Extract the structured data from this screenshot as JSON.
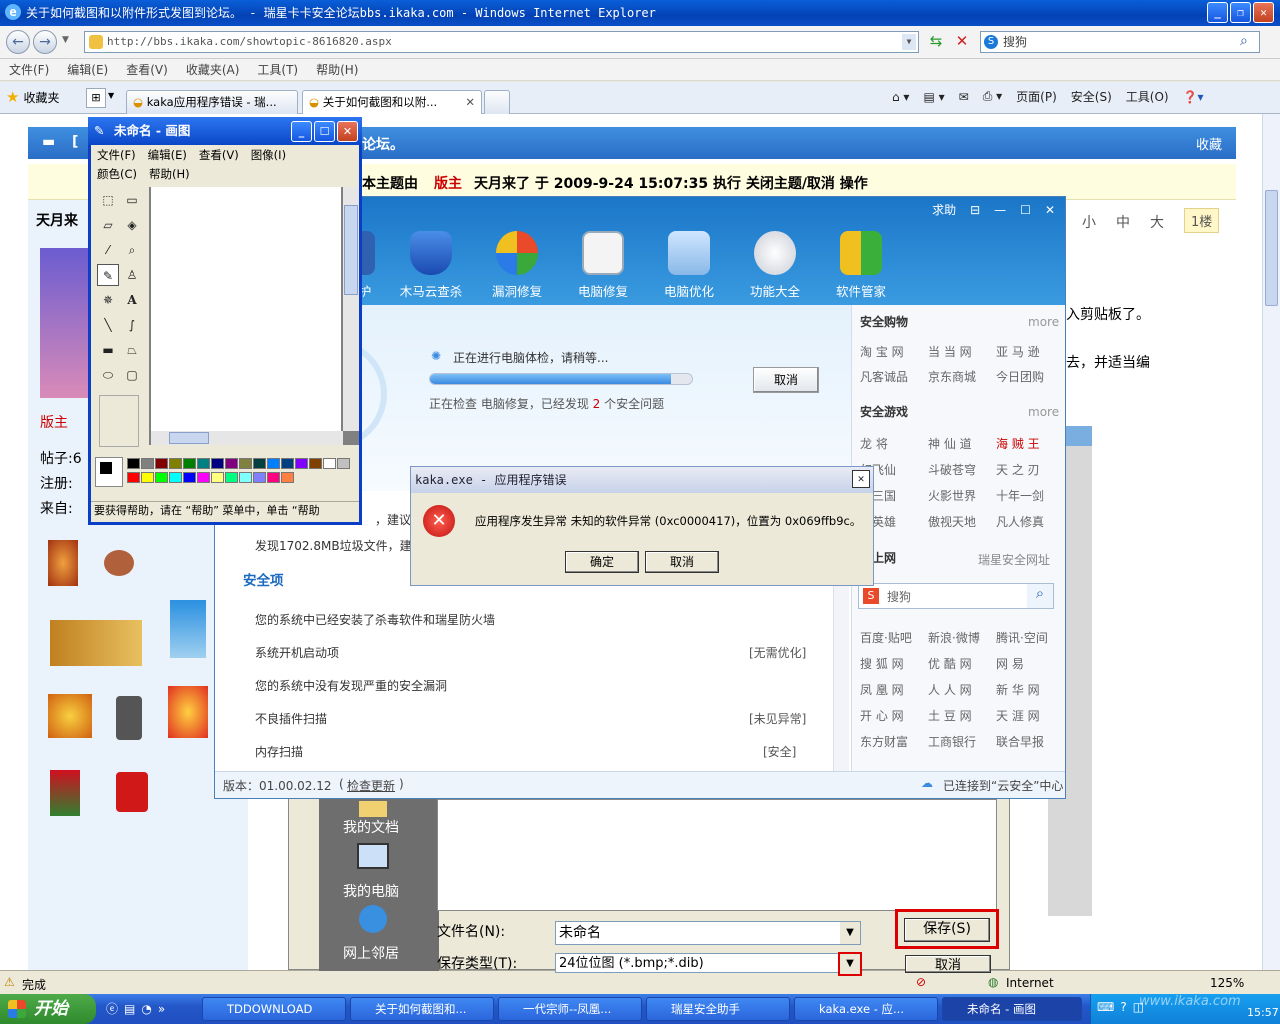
{
  "ie": {
    "title": "关于如何截图和以附件形式发图到论坛。 - 瑞星卡卡安全论坛bbs.ikaka.com - Windows Internet Explorer",
    "url": "http://bbs.ikaka.com/showtopic-8616820.aspx",
    "search_placeholder": "搜狗",
    "menu": [
      "文件(F)",
      "编辑(E)",
      "查看(V)",
      "收藏夹(A)",
      "工具(T)",
      "帮助(H)"
    ],
    "favorites": "收藏夹",
    "tabs": [
      "kaka应用程序错误 - 瑞...",
      "关于如何截图和以附..."
    ],
    "toolbar": [
      "页面(P)",
      "安全(S)",
      "工具(O)"
    ],
    "status": "完成",
    "zone": "Internet",
    "zoom": "125%"
  },
  "forum": {
    "header_title": "[",
    "header_title_tail": "论坛。",
    "header_fav": "收藏",
    "notice": "本主题由",
    "notice_role": "版主",
    "notice_rest": "天月来了 于 2009-9-24 15:07:35 执行 关闭主题/取消 操作",
    "author_name": "天月来",
    "font_small": "小",
    "font_mid": "中",
    "font_large": "大",
    "floor": "1楼",
    "role": "版主",
    "stat_posts": "帖子:6",
    "stat_reg": "注册:",
    "stat_from": "来自:",
    "text1": "入剪贴板了。",
    "text2": "去，并适当编"
  },
  "paint": {
    "title": "未命名 - 画图",
    "menu1": [
      "文件(F)",
      "编辑(E)",
      "查看(V)",
      "图像(I)"
    ],
    "menu2": [
      "颜色(C)",
      "帮助(H)"
    ],
    "status": "要获得帮助，请在 “帮助” 菜单中，单击 “帮助"
  },
  "kaka": {
    "help": "求助",
    "icons": [
      "护",
      "木马云查杀",
      "漏洞修复",
      "电脑修复",
      "电脑优化",
      "功能大全",
      "软件管家"
    ],
    "check_text": "正在进行电脑体检，请稍等...",
    "progress": 0.92,
    "cancel": "取消",
    "check_status_a": "正在检查 电脑修复，已经发现",
    "check_status_num": "2",
    "check_status_b": "个安全问题",
    "row_partial1": "，建议",
    "row_junk": "发现1702.8MB垃圾文件，建议",
    "section": "安全项",
    "rows": [
      {
        "text": "您的系统中已经安装了杀毒软件和瑞星防火墙",
        "status": ""
      },
      {
        "text": "系统开机启动项",
        "status": "[无需优化]"
      },
      {
        "text": "您的系统中没有发现严重的安全漏洞",
        "status": ""
      },
      {
        "text": "不良插件扫描",
        "status": "[未见异常]"
      },
      {
        "text": "内存扫描",
        "status": "[安全]"
      }
    ],
    "version": "版本：01.00.02.12",
    "check_update": "检查更新",
    "cloud": "已连接到“云安全”中心",
    "shop_title": "安全购物",
    "more": "more",
    "shop_links": [
      [
        "淘 宝 网",
        "当 当 网",
        "亚 马 逊"
      ],
      [
        "凡客诚品",
        "京东商城",
        "今日团购"
      ]
    ],
    "game_title": "安全游戏",
    "game_links": [
      [
        "龙 将",
        "神 仙 道",
        "海 贼 王"
      ],
      [
        "幻飞仙",
        "斗破苍穹",
        "天 之 刃"
      ],
      [
        "世三国",
        "火影世界",
        "十年一剑"
      ],
      [
        "地英雄",
        "傲视天地",
        "凡人修真"
      ]
    ],
    "web_title": "全上网",
    "web_site": "瑞星安全网址",
    "search_placeholder": "搜狗",
    "web_links": [
      [
        "百度·贴吧",
        "新浪·微博",
        "腾讯·空间"
      ],
      [
        "搜 狐 网",
        "优 酷 网",
        "网 易"
      ],
      [
        "凤 凰 网",
        "人 人 网",
        "新 华 网"
      ],
      [
        "开 心 网",
        "土 豆 网",
        "天 涯 网"
      ],
      [
        "东方财富",
        "工商银行",
        "联合早报"
      ]
    ]
  },
  "error": {
    "title": "kaka.exe - 应用程序错误",
    "message": "应用程序发生异常 未知的软件异常 (0xc0000417)，位置为 0x069ffb9c。",
    "ok": "确定",
    "cancel": "取消"
  },
  "save": {
    "places": [
      "我的文档",
      "我的电脑",
      "网上邻居"
    ],
    "filename_label": "文件名(N):",
    "filename_value": "未命名",
    "filetype_label": "保存类型(T):",
    "filetype_value": "24位位图 (*.bmp;*.dib)",
    "save_btn": "保存(S)",
    "cancel_btn": "取消"
  },
  "taskbar": {
    "start": "开始",
    "tasks": [
      "TDDOWNLOAD",
      "关于如何截图和...",
      "一代宗师--凤凰...",
      "瑞星安全助手",
      "kaka.exe - 应...",
      "未命名 - 画图"
    ],
    "watermark": "www.ikaka.com",
    "clock": "15:57"
  }
}
